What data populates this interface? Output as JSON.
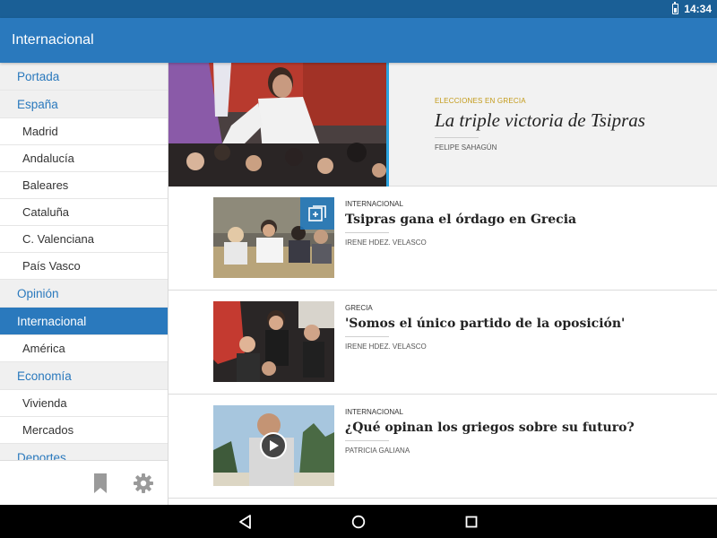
{
  "status_bar": {
    "time": "14:34"
  },
  "app_bar": {
    "title": "Internacional"
  },
  "sidebar": {
    "items": [
      {
        "label": "Portada",
        "kind": "section"
      },
      {
        "label": "España",
        "kind": "section"
      },
      {
        "label": "Madrid",
        "kind": "sub"
      },
      {
        "label": "Andalucía",
        "kind": "sub"
      },
      {
        "label": "Baleares",
        "kind": "sub"
      },
      {
        "label": "Cataluña",
        "kind": "sub"
      },
      {
        "label": "C. Valenciana",
        "kind": "sub"
      },
      {
        "label": "País Vasco",
        "kind": "sub"
      },
      {
        "label": "Opinión",
        "kind": "section"
      },
      {
        "label": "Internacional",
        "kind": "section",
        "active": true
      },
      {
        "label": "América",
        "kind": "sub"
      },
      {
        "label": "Economía",
        "kind": "section"
      },
      {
        "label": "Vivienda",
        "kind": "sub"
      },
      {
        "label": "Mercados",
        "kind": "sub"
      },
      {
        "label": "Deportes",
        "kind": "section"
      }
    ],
    "footer_icons": [
      "bookmark-icon",
      "gear-icon"
    ]
  },
  "hero": {
    "kicker": "ELECCIONES EN GRECIA",
    "title": "La triple victoria de Tsipras",
    "byline": "FELIPE SAHAGÚN"
  },
  "articles": [
    {
      "kicker": "INTERNACIONAL",
      "title": "Tsipras gana el órdago en Grecia",
      "byline": "IRENE HDEZ. VELASCO",
      "badge": "gallery-icon"
    },
    {
      "kicker": "GRECIA",
      "title": "'Somos el único partido de la oposición'",
      "byline": "IRENE HDEZ. VELASCO",
      "badge": ""
    },
    {
      "kicker": "INTERNACIONAL",
      "title": "¿Qué opinan los griegos sobre su futuro?",
      "byline": "PATRICIA GALIANA",
      "badge": "play-icon"
    }
  ],
  "colors": {
    "app_bar": "#2a79bd",
    "status_bar": "#1a5f96",
    "kicker_gold": "#c39a18",
    "accent_line": "#2aa3e0"
  }
}
